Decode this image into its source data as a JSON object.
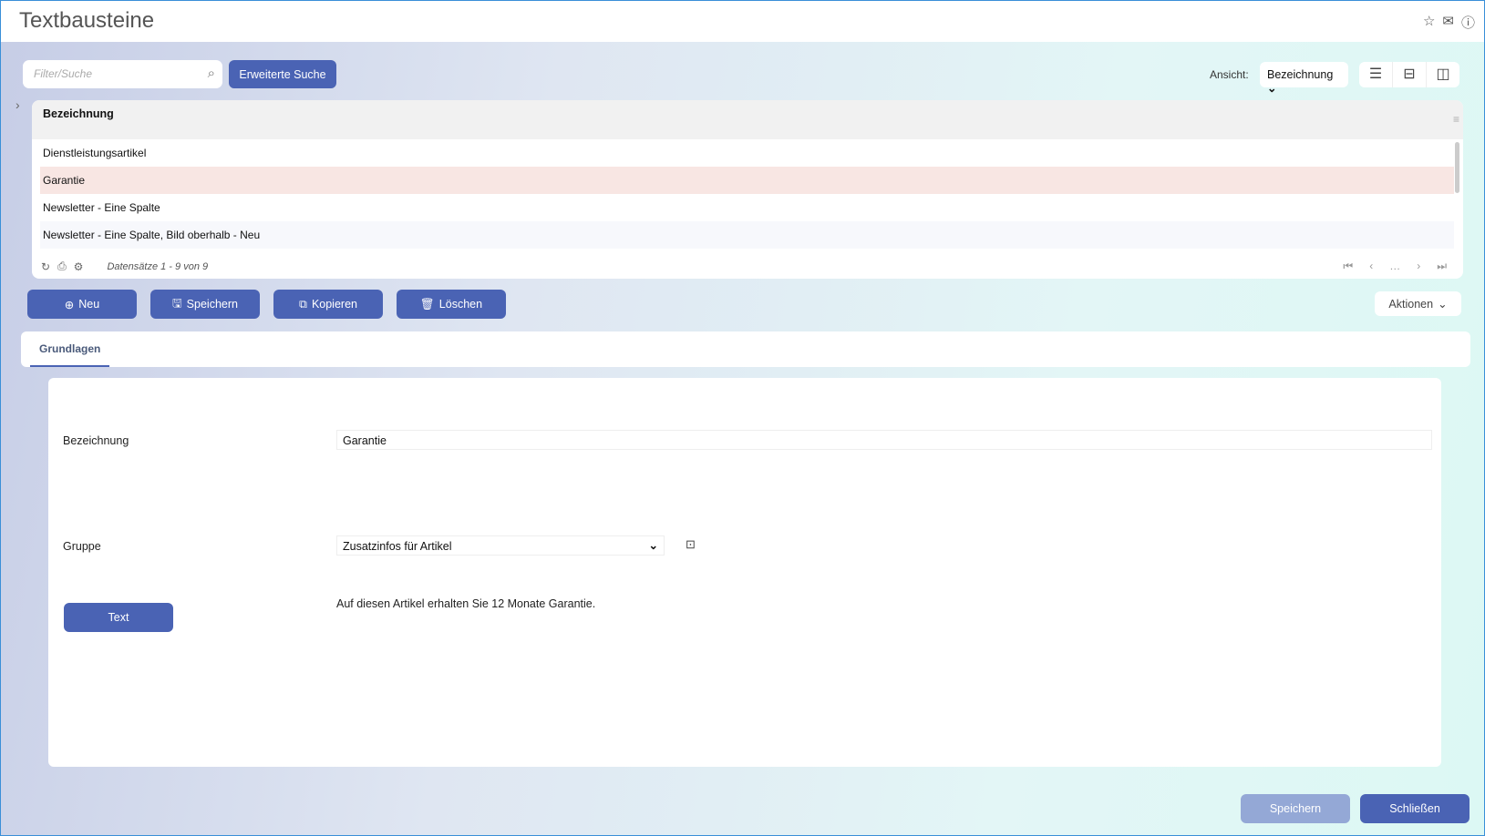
{
  "header": {
    "title": "Textbausteine",
    "icons": [
      "star-icon",
      "mail-icon",
      "help-icon"
    ]
  },
  "toolbar": {
    "search_placeholder": "Filter/Suche",
    "advanced_search": "Erweiterte Suche",
    "view_label": "Ansicht:",
    "view_value": "Bezeichnung"
  },
  "grid": {
    "column": "Bezeichnung",
    "rows": [
      "Dienstleistungsartikel",
      "Garantie",
      "Newsletter - Eine Spalte",
      "Newsletter - Eine Spalte, Bild oberhalb - Neu"
    ],
    "selected_index": 1,
    "records": "Datensätze 1 - 9 von 9"
  },
  "actions": {
    "new": "Neu",
    "save": "Speichern",
    "copy": "Kopieren",
    "delete": "Löschen",
    "more": "Aktionen"
  },
  "tabs": [
    "Grundlagen"
  ],
  "form": {
    "name_label": "Bezeichnung",
    "name_value": "Garantie",
    "group_label": "Gruppe",
    "group_value": "Zusatzinfos für Artikel",
    "text_button": "Text",
    "text_value": "Auf diesen Artikel erhalten Sie 12 Monate Garantie."
  },
  "footer": {
    "save": "Speichern",
    "close": "Schließen"
  }
}
